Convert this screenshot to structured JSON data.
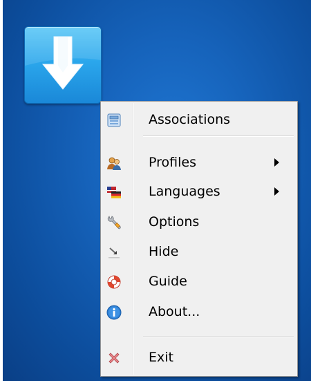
{
  "desktop": {
    "background_color": "#1663bb",
    "app_icon": "download-arrow-icon"
  },
  "menu": {
    "items": [
      {
        "label": "Associations",
        "icon": "associations-icon",
        "has_submenu": false
      },
      {
        "label": "Profiles",
        "icon": "profiles-icon",
        "has_submenu": true
      },
      {
        "label": "Languages",
        "icon": "languages-icon",
        "has_submenu": true
      },
      {
        "label": "Options",
        "icon": "wrench-icon",
        "has_submenu": false
      },
      {
        "label": "Hide",
        "icon": "hide-icon",
        "has_submenu": false
      },
      {
        "label": "Guide",
        "icon": "lifebuoy-icon",
        "has_submenu": false
      },
      {
        "label": "About...",
        "icon": "info-icon",
        "has_submenu": false
      },
      {
        "label": "Exit",
        "icon": "exit-icon",
        "has_submenu": false
      }
    ]
  }
}
